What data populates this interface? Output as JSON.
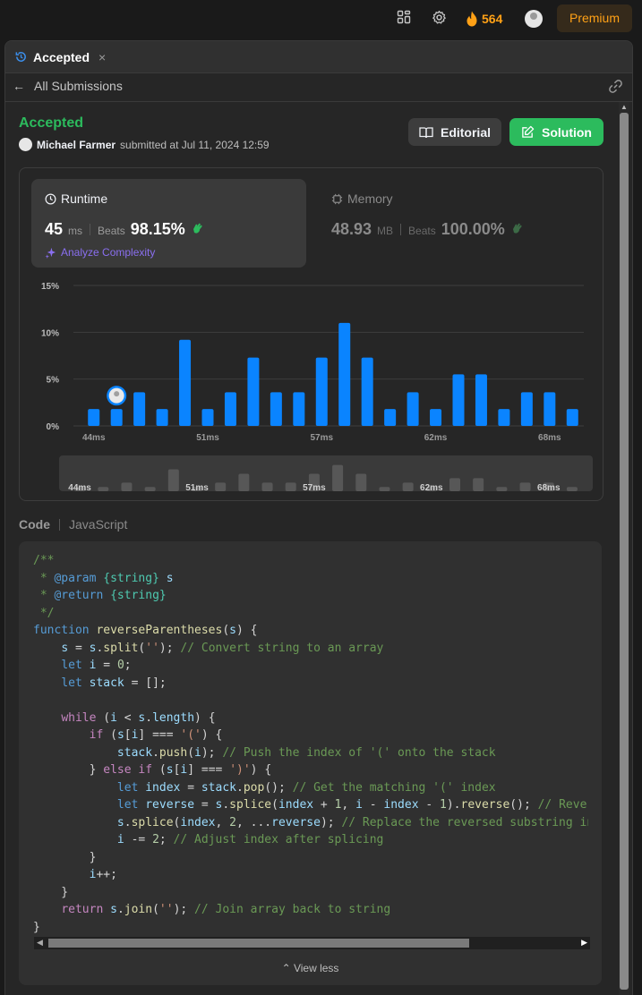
{
  "topbar": {
    "streak_count": "564",
    "premium_label": "Premium"
  },
  "tab": {
    "label": "Accepted",
    "close": "×"
  },
  "subbar": {
    "back_label": "All Submissions"
  },
  "submission": {
    "status": "Accepted",
    "user": "Michael Farmer",
    "submitted_text": "submitted at Jul 11, 2024 12:59",
    "editorial_label": "Editorial",
    "solution_label": "Solution"
  },
  "runtime": {
    "title": "Runtime",
    "value": "45",
    "unit": "ms",
    "beats_label": "Beats",
    "beats_value": "98.15%",
    "analyze_label": "Analyze Complexity"
  },
  "memory": {
    "title": "Memory",
    "value": "48.93",
    "unit": "MB",
    "beats_label": "Beats",
    "beats_value": "100.00%"
  },
  "chart_data": {
    "type": "bar",
    "y_ticks": [
      "15%",
      "10%",
      "5%",
      "0%"
    ],
    "ylim": [
      0,
      15
    ],
    "x_tick_labels": [
      "44ms",
      "51ms",
      "57ms",
      "62ms",
      "68ms"
    ],
    "values": [
      1.8,
      1.8,
      3.6,
      1.8,
      9.2,
      1.8,
      3.6,
      7.3,
      3.6,
      3.6,
      7.3,
      11.0,
      7.3,
      1.8,
      3.6,
      1.8,
      5.5,
      5.5,
      1.8,
      3.6,
      3.6,
      1.8
    ],
    "highlight_index": 1,
    "bar_color": "#0a84ff",
    "navigator_labels": [
      "44ms",
      "51ms",
      "57ms",
      "62ms",
      "68ms"
    ]
  },
  "code": {
    "label": "Code",
    "language": "JavaScript",
    "view_less": "View less"
  }
}
